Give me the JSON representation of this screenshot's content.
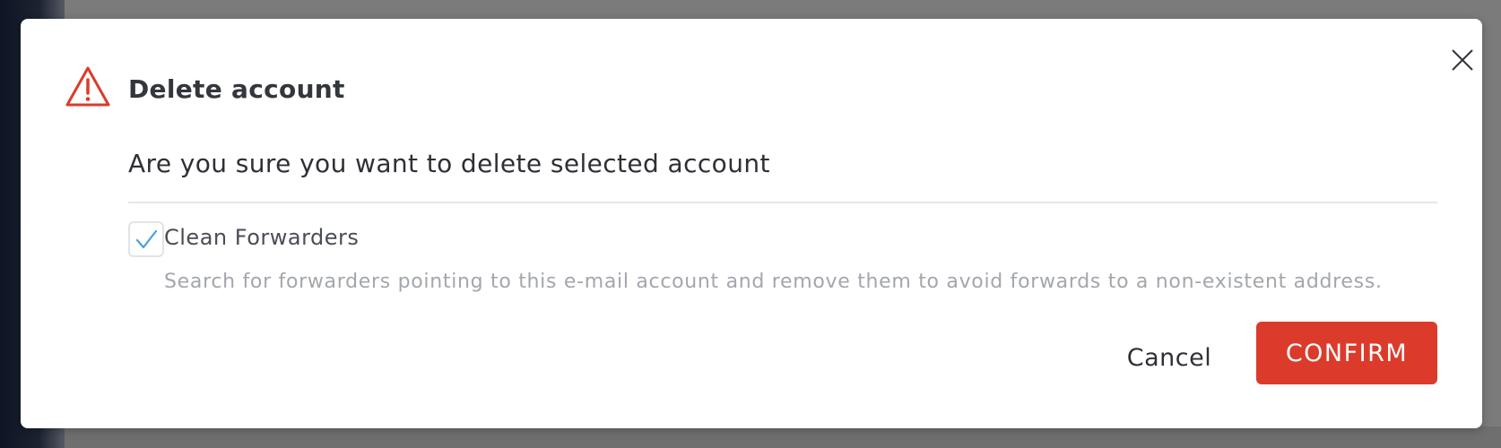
{
  "dialog": {
    "title": "Delete account",
    "message": "Are you sure you want to delete selected account",
    "icons": {
      "warning": "warning-triangle-icon",
      "close": "close-icon",
      "check": "checkmark-icon"
    },
    "colors": {
      "danger": "#dc3b2b",
      "check": "#4a9ee0"
    },
    "option": {
      "label": "Clean Forwarders",
      "checked": true,
      "description": "Search for forwarders pointing to this e-mail account and remove them to avoid forwards to a non-existent address."
    },
    "buttons": {
      "cancel": "Cancel",
      "confirm": "CONFIRM"
    }
  }
}
